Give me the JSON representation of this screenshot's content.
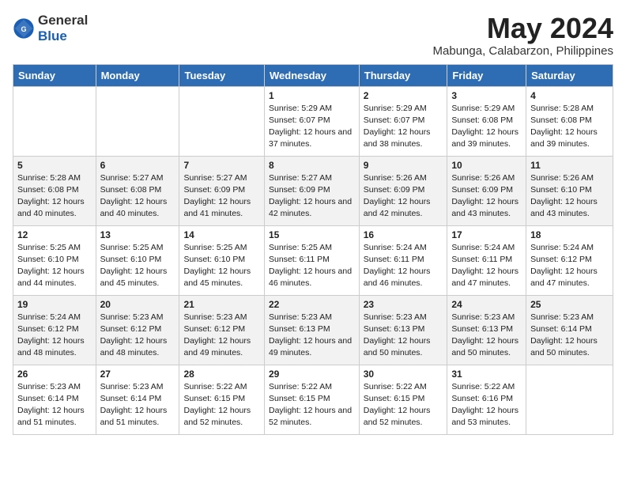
{
  "logo": {
    "general": "General",
    "blue": "Blue"
  },
  "title": "May 2024",
  "location": "Mabunga, Calabarzon, Philippines",
  "days": [
    "Sunday",
    "Monday",
    "Tuesday",
    "Wednesday",
    "Thursday",
    "Friday",
    "Saturday"
  ],
  "weeks": [
    [
      {
        "day": "",
        "info": ""
      },
      {
        "day": "",
        "info": ""
      },
      {
        "day": "",
        "info": ""
      },
      {
        "day": "1",
        "info": "Sunrise: 5:29 AM\nSunset: 6:07 PM\nDaylight: 12 hours and 37 minutes."
      },
      {
        "day": "2",
        "info": "Sunrise: 5:29 AM\nSunset: 6:07 PM\nDaylight: 12 hours and 38 minutes."
      },
      {
        "day": "3",
        "info": "Sunrise: 5:29 AM\nSunset: 6:08 PM\nDaylight: 12 hours and 39 minutes."
      },
      {
        "day": "4",
        "info": "Sunrise: 5:28 AM\nSunset: 6:08 PM\nDaylight: 12 hours and 39 minutes."
      }
    ],
    [
      {
        "day": "5",
        "info": "Sunrise: 5:28 AM\nSunset: 6:08 PM\nDaylight: 12 hours and 40 minutes."
      },
      {
        "day": "6",
        "info": "Sunrise: 5:27 AM\nSunset: 6:08 PM\nDaylight: 12 hours and 40 minutes."
      },
      {
        "day": "7",
        "info": "Sunrise: 5:27 AM\nSunset: 6:09 PM\nDaylight: 12 hours and 41 minutes."
      },
      {
        "day": "8",
        "info": "Sunrise: 5:27 AM\nSunset: 6:09 PM\nDaylight: 12 hours and 42 minutes."
      },
      {
        "day": "9",
        "info": "Sunrise: 5:26 AM\nSunset: 6:09 PM\nDaylight: 12 hours and 42 minutes."
      },
      {
        "day": "10",
        "info": "Sunrise: 5:26 AM\nSunset: 6:09 PM\nDaylight: 12 hours and 43 minutes."
      },
      {
        "day": "11",
        "info": "Sunrise: 5:26 AM\nSunset: 6:10 PM\nDaylight: 12 hours and 43 minutes."
      }
    ],
    [
      {
        "day": "12",
        "info": "Sunrise: 5:25 AM\nSunset: 6:10 PM\nDaylight: 12 hours and 44 minutes."
      },
      {
        "day": "13",
        "info": "Sunrise: 5:25 AM\nSunset: 6:10 PM\nDaylight: 12 hours and 45 minutes."
      },
      {
        "day": "14",
        "info": "Sunrise: 5:25 AM\nSunset: 6:10 PM\nDaylight: 12 hours and 45 minutes."
      },
      {
        "day": "15",
        "info": "Sunrise: 5:25 AM\nSunset: 6:11 PM\nDaylight: 12 hours and 46 minutes."
      },
      {
        "day": "16",
        "info": "Sunrise: 5:24 AM\nSunset: 6:11 PM\nDaylight: 12 hours and 46 minutes."
      },
      {
        "day": "17",
        "info": "Sunrise: 5:24 AM\nSunset: 6:11 PM\nDaylight: 12 hours and 47 minutes."
      },
      {
        "day": "18",
        "info": "Sunrise: 5:24 AM\nSunset: 6:12 PM\nDaylight: 12 hours and 47 minutes."
      }
    ],
    [
      {
        "day": "19",
        "info": "Sunrise: 5:24 AM\nSunset: 6:12 PM\nDaylight: 12 hours and 48 minutes."
      },
      {
        "day": "20",
        "info": "Sunrise: 5:23 AM\nSunset: 6:12 PM\nDaylight: 12 hours and 48 minutes."
      },
      {
        "day": "21",
        "info": "Sunrise: 5:23 AM\nSunset: 6:12 PM\nDaylight: 12 hours and 49 minutes."
      },
      {
        "day": "22",
        "info": "Sunrise: 5:23 AM\nSunset: 6:13 PM\nDaylight: 12 hours and 49 minutes."
      },
      {
        "day": "23",
        "info": "Sunrise: 5:23 AM\nSunset: 6:13 PM\nDaylight: 12 hours and 50 minutes."
      },
      {
        "day": "24",
        "info": "Sunrise: 5:23 AM\nSunset: 6:13 PM\nDaylight: 12 hours and 50 minutes."
      },
      {
        "day": "25",
        "info": "Sunrise: 5:23 AM\nSunset: 6:14 PM\nDaylight: 12 hours and 50 minutes."
      }
    ],
    [
      {
        "day": "26",
        "info": "Sunrise: 5:23 AM\nSunset: 6:14 PM\nDaylight: 12 hours and 51 minutes."
      },
      {
        "day": "27",
        "info": "Sunrise: 5:23 AM\nSunset: 6:14 PM\nDaylight: 12 hours and 51 minutes."
      },
      {
        "day": "28",
        "info": "Sunrise: 5:22 AM\nSunset: 6:15 PM\nDaylight: 12 hours and 52 minutes."
      },
      {
        "day": "29",
        "info": "Sunrise: 5:22 AM\nSunset: 6:15 PM\nDaylight: 12 hours and 52 minutes."
      },
      {
        "day": "30",
        "info": "Sunrise: 5:22 AM\nSunset: 6:15 PM\nDaylight: 12 hours and 52 minutes."
      },
      {
        "day": "31",
        "info": "Sunrise: 5:22 AM\nSunset: 6:16 PM\nDaylight: 12 hours and 53 minutes."
      },
      {
        "day": "",
        "info": ""
      }
    ]
  ]
}
